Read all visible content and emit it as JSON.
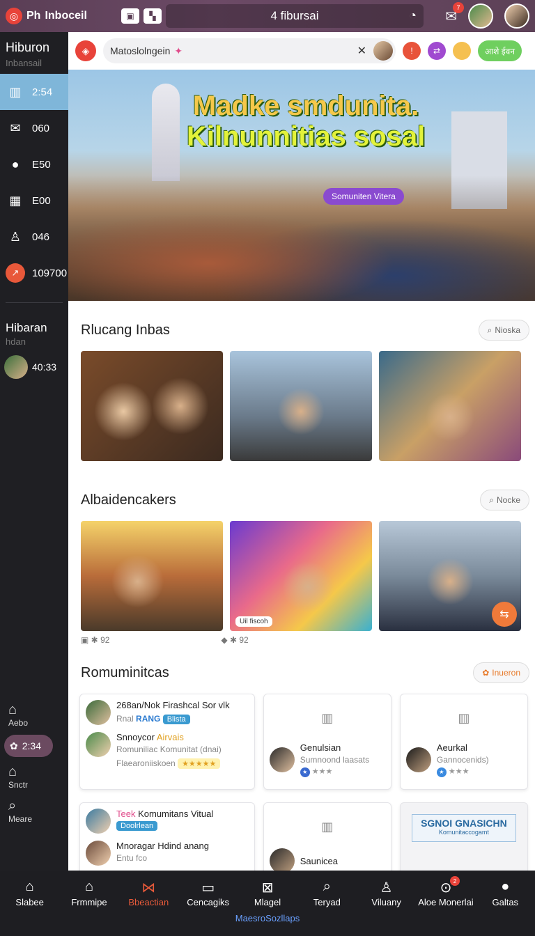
{
  "topbar": {
    "brand": "Ph",
    "brand_rest": "Inboceil",
    "title": "4  fibursai",
    "mail_badge": "7"
  },
  "sidebar": {
    "title": "Hiburon",
    "subtitle": "Inbansail",
    "items": [
      {
        "label": "2:54",
        "icon": "store-icon"
      },
      {
        "label": "060",
        "icon": "mail-icon"
      },
      {
        "label": "E50",
        "icon": "user-icon"
      },
      {
        "label": "E00",
        "icon": "building-icon"
      },
      {
        "label": "046",
        "icon": "person-icon"
      },
      {
        "label": "109700",
        "icon": "trend-icon"
      }
    ],
    "section_title": "Hibaran",
    "section_subtitle": "hdan",
    "user_label": "40:33",
    "bottom": [
      {
        "label": "Aebo",
        "icon": "home-icon"
      },
      {
        "label": "2:34",
        "icon": "flower-icon"
      },
      {
        "label": "Snctr",
        "icon": "house-icon"
      },
      {
        "label": "Meare",
        "icon": "search-icon"
      }
    ]
  },
  "search": {
    "value": "Matoslolngein",
    "clear": "✕",
    "join_label": "आशे ईवन"
  },
  "hero": {
    "title_line1": "Madke smdunita.",
    "title_line2": "Kilnunnitias sosal",
    "chip": "Somuniten Vitera"
  },
  "sections": [
    {
      "title": "Rlucang Inbas",
      "button": "Nioska"
    },
    {
      "title": "Albaidencakers",
      "button": "Nocke"
    },
    {
      "title": "Romuminitcas",
      "button": "Inueron"
    }
  ],
  "media": {
    "tag": "Uil fiscoh",
    "count1": "92",
    "count2": "92"
  },
  "cards": {
    "c1_title": "268an/Nok Firashcal Sor vlk",
    "c1_sub": "Rnal",
    "c1_rang": "RANG",
    "c1_tag": "Blista",
    "c1b_title": "Snnoycor",
    "c1b_title_hl": "Airvais",
    "c1b_sub": "Romuniliac Komunitat (dnai)",
    "c1b_sub2": "Flaearoniiskoen",
    "c1b_stars": "★★★★★",
    "c2_title": "Genulsian",
    "c2_sub": "Sumnoond laasats",
    "c2_rate": "★★★",
    "c3_title": "Aeurkal",
    "c3_sub": "Gannocenids)",
    "c3_rate": "★★★",
    "c4_title_a": "Teek",
    "c4_title_b": "Komumitans Vitual",
    "c4_tag": "Doolrlean",
    "c4b_title": "Mnoragar",
    "c4b_title_rest": "Hdind anang",
    "c4b_sub": "Entu fco",
    "c5_title": "Saunicea",
    "c6_banner": "SGNOI GNASICHN",
    "c6_banner_small": "Komunitaccogamt"
  },
  "bottomnav": {
    "items": [
      {
        "label": "Slabee",
        "icon": "home-icon"
      },
      {
        "label": "Frmmipe",
        "icon": "house-icon"
      },
      {
        "label": "Bbeactian",
        "icon": "butterfly-icon"
      },
      {
        "label": "Cencagiks",
        "icon": "camera-icon"
      },
      {
        "label": "Mlagel",
        "icon": "close-box-icon"
      },
      {
        "label": "Teryad",
        "icon": "search-icon"
      },
      {
        "label": "Viluany",
        "icon": "person-icon"
      },
      {
        "label": "Aloe Monerlai",
        "icon": "circle-play-icon"
      },
      {
        "label": "Galtas",
        "icon": "user-icon"
      }
    ],
    "badge": "2",
    "footer": "MaesroSozllaps"
  }
}
